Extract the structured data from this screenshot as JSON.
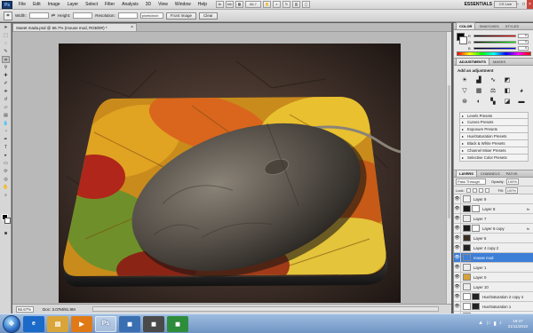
{
  "app": {
    "logo_text": "Ps",
    "menu": [
      "File",
      "Edit",
      "Image",
      "Layer",
      "Select",
      "Filter",
      "Analysis",
      "3D",
      "View",
      "Window",
      "Help"
    ],
    "zoom_display": "66.7",
    "workspace": "ESSENTIALS",
    "cs_live": "CS Live",
    "window_controls": [
      "–",
      "□",
      "×"
    ]
  },
  "options_bar": {
    "width_label": "Width:",
    "height_label": "Height:",
    "resolution_label": "Resolution:",
    "resolution_unit": "pixels/inch",
    "front_image_label": "Front Image",
    "clear_label": "Clear"
  },
  "document": {
    "tab_title": "Sweet mada.psd @ 66.7% (mouse mod, RGB/8#) *",
    "zoom": "66.67%",
    "doc_size": "Doc: 3.07M/91.9M"
  },
  "color_panel": {
    "tabs": [
      "COLOR",
      "SWATCHES",
      "STYLES"
    ],
    "channels": [
      {
        "ch": "R",
        "value": "0",
        "grad": [
          "#000000",
          "#ff0000"
        ]
      },
      {
        "ch": "G",
        "value": "0",
        "grad": [
          "#000000",
          "#00ff00"
        ]
      },
      {
        "ch": "B",
        "value": "0",
        "grad": [
          "#000000",
          "#0000ff"
        ]
      }
    ]
  },
  "adjustments_panel": {
    "tabs": [
      "ADJUSTMENTS",
      "MASKS"
    ],
    "title": "Add an adjustment",
    "presets": [
      "Levels Presets",
      "Curves Presets",
      "Exposure Presets",
      "Hue/Saturation Presets",
      "Black & White Presets",
      "Channel Mixer Presets",
      "Selective Color Presets"
    ]
  },
  "layers_panel": {
    "tabs": [
      "LAYERS",
      "CHANNELS",
      "PATHS"
    ],
    "blend_mode": "Pass Through",
    "opacity_label": "Opacity:",
    "opacity": "100%",
    "lock_label": "Lock:",
    "fill_label": "Fill:",
    "fill": "100%",
    "layers": [
      {
        "name": "Layer 9",
        "selected": false,
        "thumb": "#f2f2f2",
        "mask": "",
        "fx": ""
      },
      {
        "name": "Layer 8",
        "selected": false,
        "thumb": "#1a1a1a",
        "mask": "#ffffff",
        "fx": "fx"
      },
      {
        "name": "Layer 7",
        "selected": false,
        "thumb": "#ececec",
        "mask": "",
        "fx": ""
      },
      {
        "name": "Layer 6 copy",
        "selected": false,
        "thumb": "#1a1a1a",
        "mask": "#ffffff",
        "fx": "fx"
      },
      {
        "name": "Layer 6",
        "selected": false,
        "thumb": "#3a2e22",
        "mask": "",
        "fx": ""
      },
      {
        "name": "Layer 4 copy 2",
        "selected": false,
        "thumb": "#222222",
        "mask": "",
        "fx": ""
      },
      {
        "name": "mouse mod",
        "selected": true,
        "thumb": "#3d7ed6",
        "mask": "",
        "fx": ""
      },
      {
        "name": "Layer 1",
        "selected": false,
        "thumb": "#ececec",
        "mask": "",
        "fx": ""
      },
      {
        "name": "Layer 0",
        "selected": false,
        "thumb": "#d6a23a",
        "mask": "",
        "fx": ""
      },
      {
        "name": "Layer 10",
        "selected": false,
        "thumb": "#ececec",
        "mask": "",
        "fx": ""
      },
      {
        "name": "Hue/Saturation 2 copy 4",
        "selected": false,
        "thumb": "#ffffff",
        "mask": "#222222",
        "fx": ""
      },
      {
        "name": "Hue/Saturation 1",
        "selected": false,
        "thumb": "#ffffff",
        "mask": "#222222",
        "fx": ""
      },
      {
        "name": "Layer 2",
        "selected": false,
        "thumb": "#3a2e22",
        "mask": "",
        "fx": ""
      }
    ],
    "bottom_icons": [
      "∞",
      "fx",
      "◐",
      "▭",
      "▤",
      "✕"
    ]
  },
  "taskbar": {
    "start_glyph": "❖",
    "apps": [
      {
        "name": "ie",
        "glyph": "e",
        "color": "#1b6ac9",
        "active": false
      },
      {
        "name": "explorer",
        "glyph": "▤",
        "color": "#d9a53a",
        "active": false
      },
      {
        "name": "media",
        "glyph": "▶",
        "color": "#e07a17",
        "active": false
      },
      {
        "name": "photoshop",
        "glyph": "Ps",
        "color": "#1b3c6e",
        "active": true
      },
      {
        "name": "pinned-1",
        "glyph": "◼",
        "color": "#3a6fb2",
        "active": false
      },
      {
        "name": "pinned-2",
        "glyph": "◼",
        "color": "#4a4a4a",
        "active": false
      },
      {
        "name": "pinned-3",
        "glyph": "◼",
        "color": "#2d8d3a",
        "active": false
      }
    ],
    "tray": [
      "▲",
      "⚐",
      "▮",
      "♪"
    ],
    "time": "19:47",
    "date": "21/11/2010"
  }
}
